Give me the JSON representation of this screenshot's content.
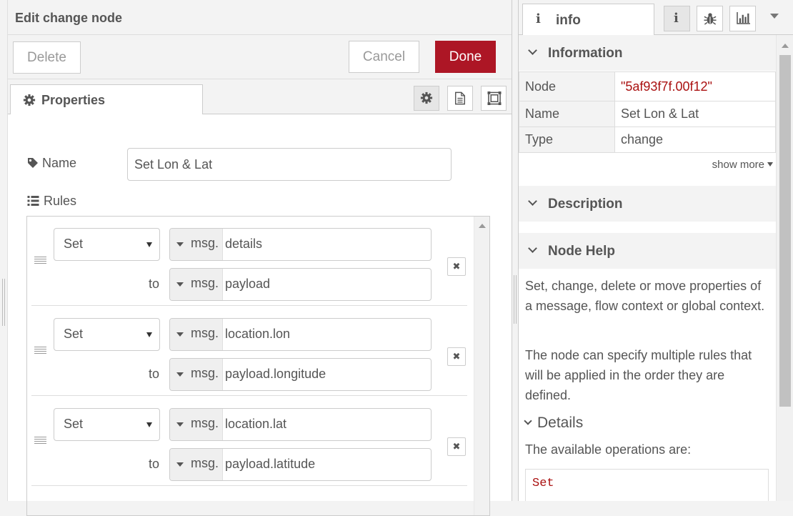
{
  "tray": {
    "title": "Edit change node",
    "delete_label": "Delete",
    "cancel_label": "Cancel",
    "done_label": "Done",
    "tab_properties": "Properties"
  },
  "form": {
    "name_label": "Name",
    "name_value": "Set Lon & Lat",
    "rules_label": "Rules",
    "to_label": "to",
    "msg_prefix": "msg.",
    "rules": [
      {
        "action": "Set",
        "target": "details",
        "source": "payload"
      },
      {
        "action": "Set",
        "target": "location.lon",
        "source": "payload.longitude"
      },
      {
        "action": "Set",
        "target": "location.lat",
        "source": "payload.latitude"
      }
    ]
  },
  "sidebar": {
    "tab_label": "info",
    "info_section": "Information",
    "info_rows": [
      {
        "key": "Node",
        "value": "\"5af93f7f.00f12\""
      },
      {
        "key": "Name",
        "value": "Set Lon & Lat"
      },
      {
        "key": "Type",
        "value": "change"
      }
    ],
    "show_more": "show more",
    "description_section": "Description",
    "help_section": "Node Help",
    "help_p1": "Set, change, delete or move properties of a message, flow context or global context.",
    "help_p2": "The node can specify multiple rules that will be applied in the order they are defined.",
    "details_heading": "Details",
    "help_p3": "The available operations are:",
    "code_text": "Set"
  },
  "colors": {
    "accent": "#ad1625",
    "node_id": "#aa1111"
  },
  "icons": [
    "cog-icon",
    "file-text-icon",
    "object-ungroup-icon",
    "tag-icon",
    "list-icon",
    "info-icon",
    "bug-icon",
    "bar-chart-icon",
    "caret-down-icon",
    "chevron-down-icon",
    "remove-icon",
    "drag-handle-icon"
  ]
}
